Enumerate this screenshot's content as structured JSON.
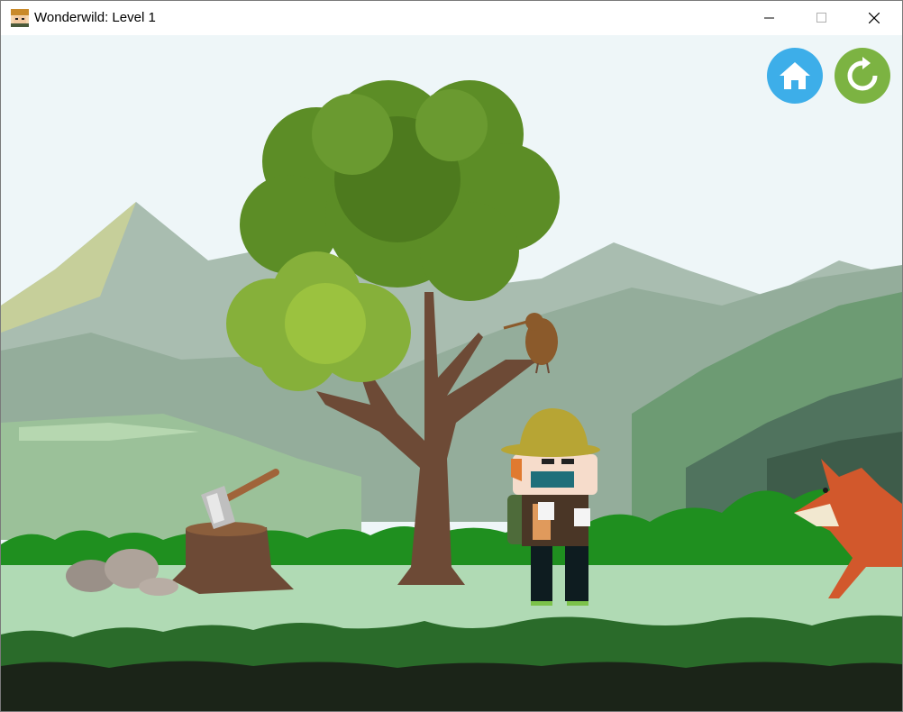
{
  "window": {
    "title": "Wonderwild: Level 1",
    "app_icon": "character-face-icon",
    "controls": [
      "minimize-icon",
      "maximize-icon",
      "close-icon"
    ]
  },
  "hud": {
    "buttons": [
      {
        "name": "home-button",
        "icon": "home-icon",
        "color": "#3daee9"
      },
      {
        "name": "restart-button",
        "icon": "restart-icon",
        "color": "#7cb342"
      }
    ]
  },
  "scene": {
    "characters": [
      "player-explorer",
      "kiwi-bird",
      "fox"
    ],
    "props": [
      "tree",
      "tree-stump-with-axe",
      "rocks"
    ],
    "colors": {
      "sky": "#eef6f8",
      "mountains": "#9cb7a2",
      "grass": "#1f8f1f",
      "path": "#b0dab4",
      "ground_dark": "#1b2418"
    }
  }
}
